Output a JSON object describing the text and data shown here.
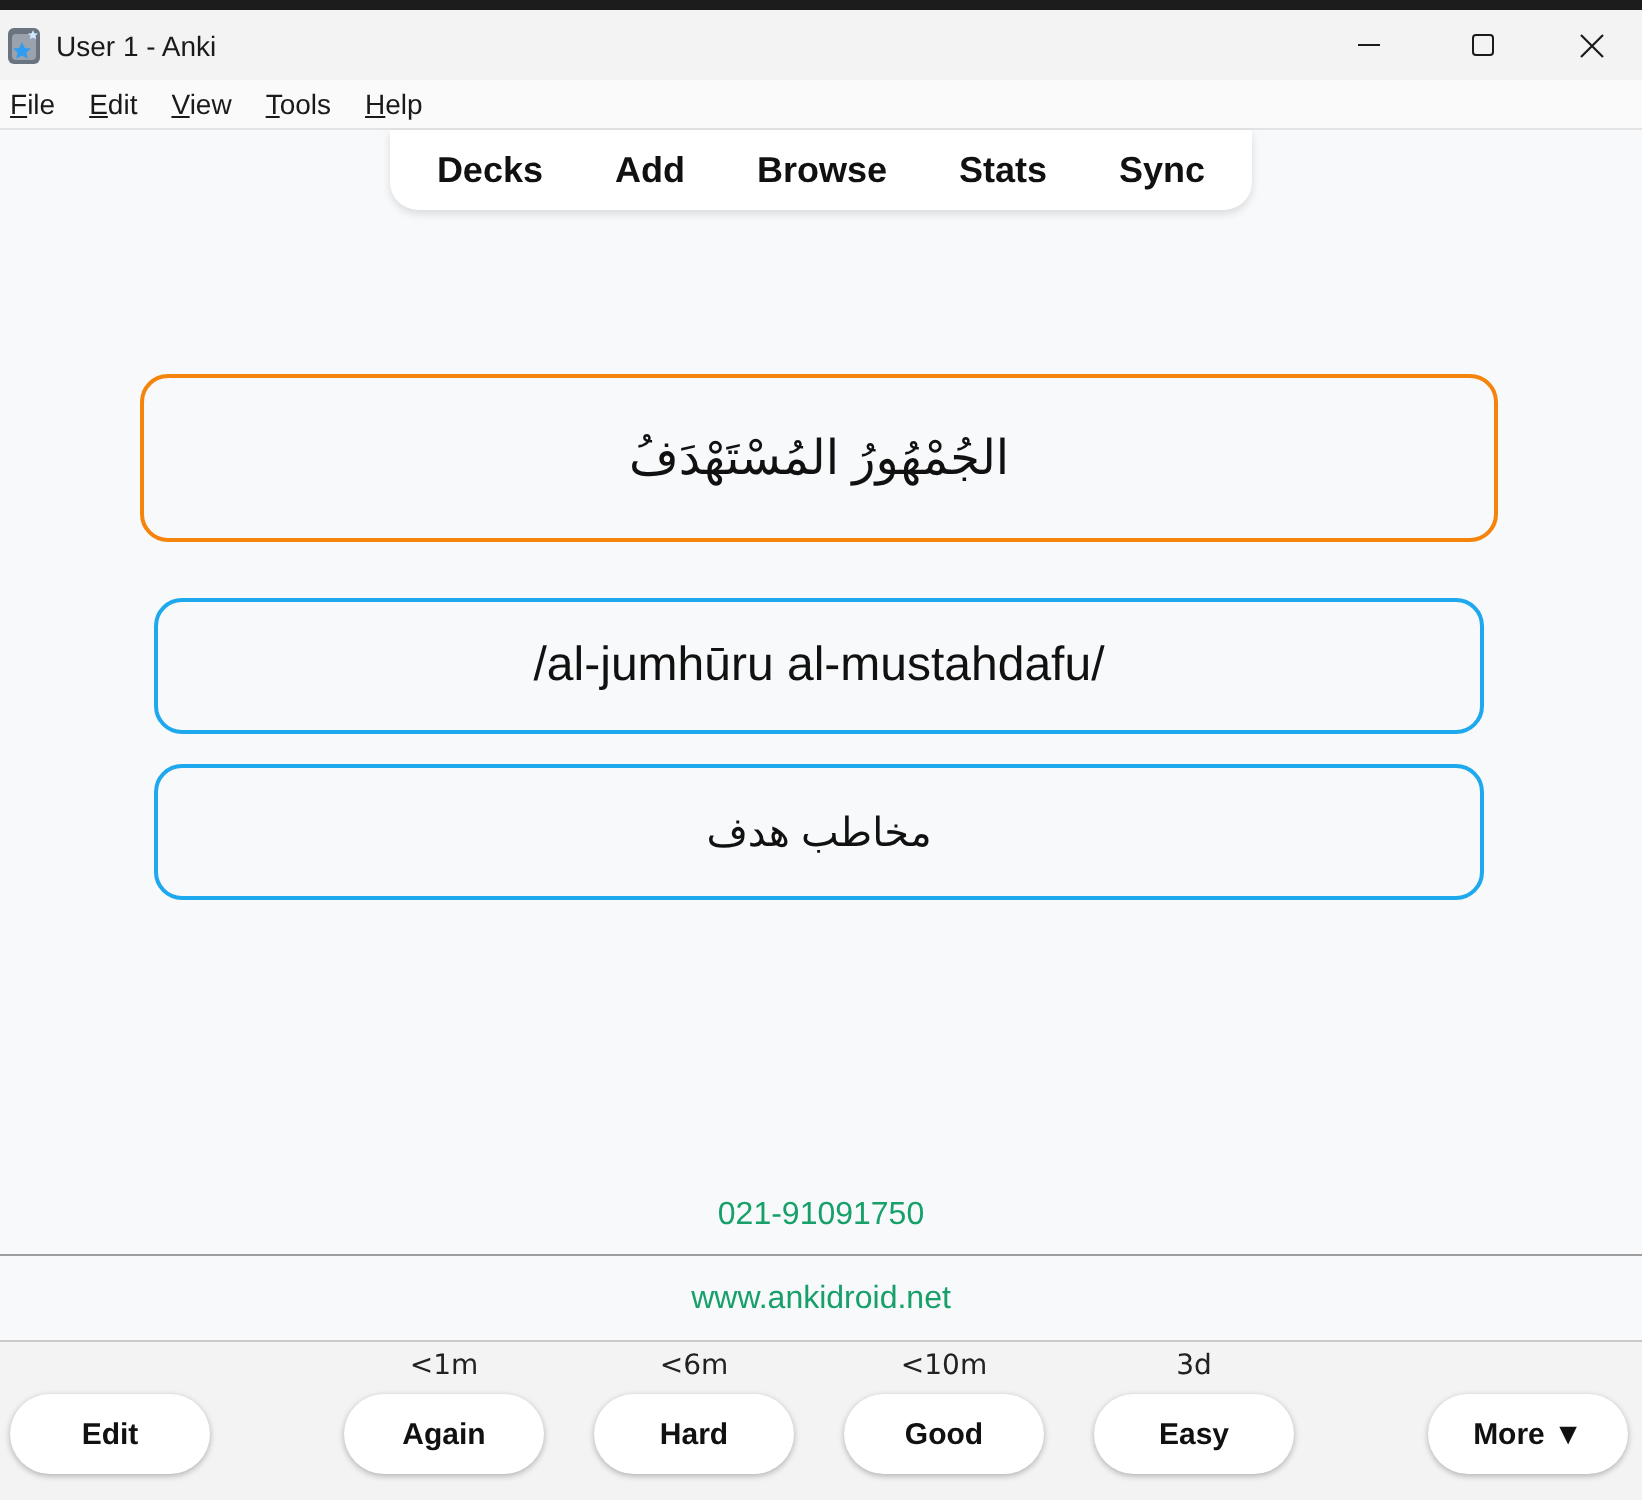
{
  "window": {
    "title": "User 1 - Anki"
  },
  "menu_bar": [
    "File",
    "Edit",
    "View",
    "Tools",
    "Help"
  ],
  "toolbar": [
    "Decks",
    "Add",
    "Browse",
    "Stats",
    "Sync"
  ],
  "card": {
    "question": "الجُمْهُورُ المُسْتَهْدَفُ",
    "answers": [
      "/al-jumhūru al-mustahdafu/",
      "مخاطب هدف"
    ]
  },
  "footer": {
    "phone": "021-91091750",
    "website": "www.ankidroid.net"
  },
  "bottom_bar": {
    "edit_button": "Edit",
    "answer_buttons": [
      {
        "interval": "<1m",
        "label": "Again"
      },
      {
        "interval": "<6m",
        "label": "Hard"
      },
      {
        "interval": "<10m",
        "label": "Good"
      },
      {
        "interval": "3d",
        "label": "Easy"
      }
    ],
    "more_button": "More ▼"
  }
}
